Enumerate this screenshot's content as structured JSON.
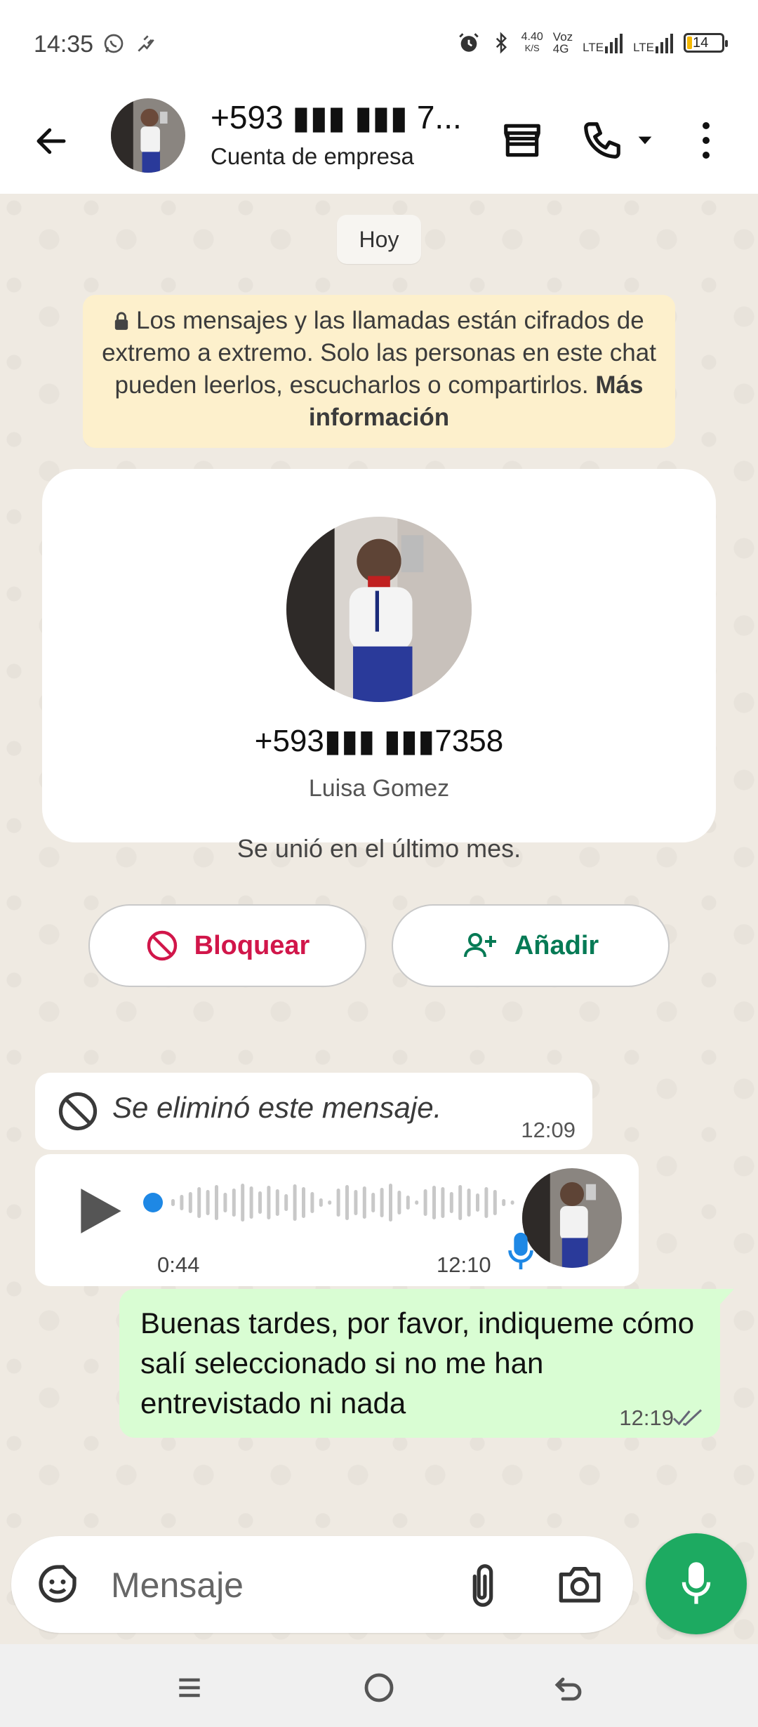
{
  "status_bar": {
    "time": "14:35",
    "net_speed_value": "4.40",
    "net_speed_unit": "K/S",
    "voz": "Voz",
    "g4": "4G",
    "lte1": "LTE",
    "lte2": "LTE",
    "battery": "14",
    "battery_fraction": 0.14
  },
  "header": {
    "contact_title": "+593 ▮▮▮ ▮▮▮ 7...",
    "subtitle": "Cuenta de empresa",
    "icons": [
      "back-arrow-icon",
      "store-icon",
      "phone-icon",
      "chevron-down-icon",
      "more-vert-icon"
    ]
  },
  "chat": {
    "date_chip": "Hoy",
    "encryption_notice": {
      "text": "Los mensajes y las llamadas están cifrados de extremo a extremo. Solo las personas en este chat pueden leerlos, escucharlos o compartirlos.",
      "link": "Más información"
    },
    "profile_card": {
      "phone": "+593▮▮▮ ▮▮▮7358",
      "name": "Luisa Gomez",
      "joined": "Se unió en el último mes.",
      "block_label": "Bloquear",
      "add_label": "Añadir"
    },
    "messages": [
      {
        "type": "deleted",
        "text": "Se eliminó este mensaje.",
        "time": "12:09"
      },
      {
        "type": "voice",
        "duration": "0:44",
        "time": "12:10",
        "progress": 0
      },
      {
        "type": "outgoing",
        "text": "Buenas tardes, por favor, indiqueme cómo salí seleccionado si no me han entrevistado ni nada",
        "time": "12:19",
        "status": "delivered"
      }
    ]
  },
  "input": {
    "placeholder": "Mensaje"
  },
  "colors": {
    "accent_green": "#1daa61",
    "outgoing_bubble": "#d9fdd3",
    "chat_bg": "#efeae2",
    "block_red": "#d1164a",
    "add_green": "#067a55",
    "notice_bg": "#fdf0cc"
  }
}
